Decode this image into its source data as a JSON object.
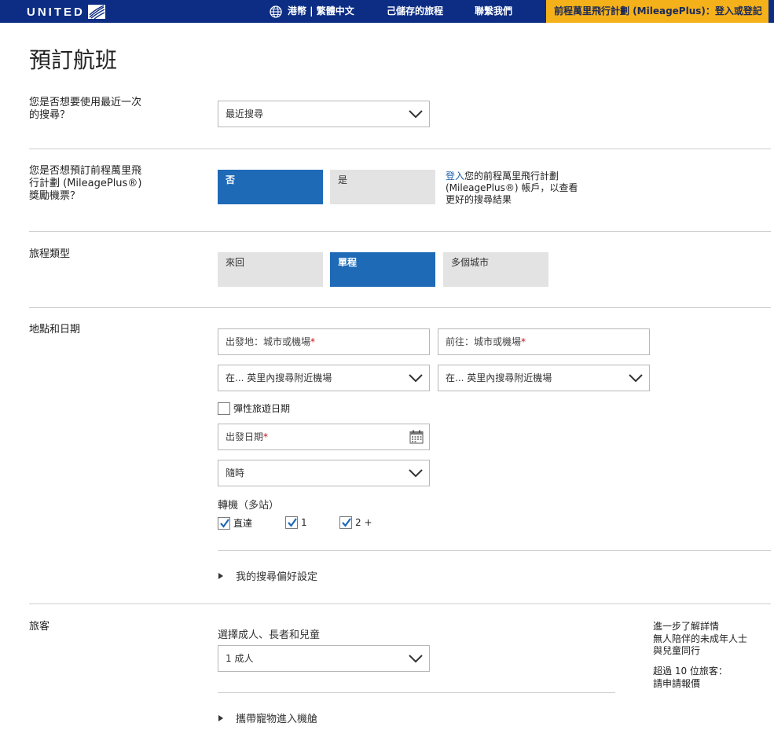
{
  "nav": {
    "logo": "UNITED",
    "lang": "港幣 | 繁體中文",
    "saved": "己儲存的旅程",
    "contact": "聯繫我們",
    "mileageplus": "前程萬里飛行計劃 (MileagePlus)：登入或登記"
  },
  "page_title": "預訂航班",
  "recent": {
    "label": "您是否想要使用最近一次的搜尋？",
    "select_value": "最近搜尋"
  },
  "award": {
    "label": "您是否想預訂前程萬里飛行計劃 (MileagePlus®) 獎勵機票？",
    "no": "否",
    "yes": "是",
    "login_link": "登入",
    "login_text": "您的前程萬里飛行計劃 (MileagePlus®) 帳戶，以查看更好的搜尋結果"
  },
  "trip": {
    "label": "旅程類型",
    "round": "來回",
    "oneway": "單程",
    "multi": "多個城市"
  },
  "location": {
    "label": "地點和日期",
    "from_placeholder": "出發地：城市或機場",
    "to_placeholder": "前往：城市或機場",
    "req": "*",
    "nearby_from": "在... 英里內搜尋附近機場",
    "nearby_to": "在... 英里內搜尋附近機場",
    "flexible": "彈性旅遊日期",
    "depart_date": "出發日期",
    "time": "隨時",
    "connections_label": "轉機（多站）",
    "nonstop": "直達",
    "one": "1",
    "twoplus": "2 +",
    "prefs": "我的搜尋偏好設定"
  },
  "travelers": {
    "label": "旅客",
    "select_label": "選擇成人、長者和兒童",
    "value": "1 成人",
    "learn_more": "進一步了解詳情",
    "unaccompanied": "無人陪伴的未成年人士與兒童同行",
    "over10": "超過 10 位旅客：",
    "quote": "請申請報價",
    "pets": "攜帶寵物進入機艙"
  },
  "colors": {
    "nav": "#0c2d83",
    "accent": "#f5b11a",
    "selected": "#1e6ab7",
    "link": "#1f5fa8"
  }
}
